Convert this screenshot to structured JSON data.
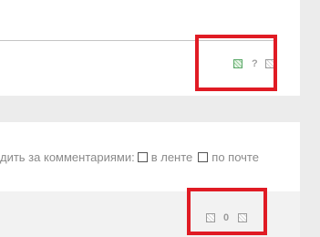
{
  "subscribe": {
    "prefix": "дить за комментариями:",
    "option_feed": "в ленте",
    "option_mail": "по почте"
  },
  "post_actions": {
    "help_label": "?"
  },
  "comment_counter": {
    "count": "0"
  },
  "colors": {
    "highlight": "#e01b24",
    "page_background": "#ececec",
    "active_icon": "#5aa868"
  },
  "icons": {
    "post_left": "grid-icon",
    "post_right": "grid-icon",
    "counter_left": "comment-icon",
    "counter_right": "grid-icon"
  }
}
